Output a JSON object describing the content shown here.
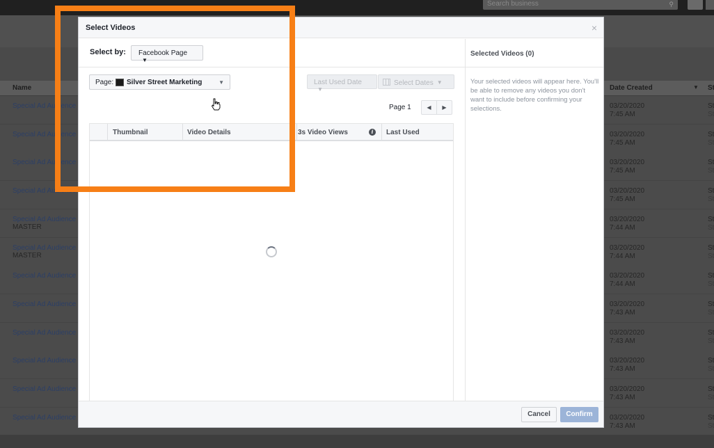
{
  "background": {
    "search_placeholder": "Search business",
    "columns": {
      "name": "Name",
      "date_created": "Date Created",
      "last_col": "St"
    },
    "rows": [
      {
        "name": "Special Ad Audience (",
        "name_line2": "",
        "date": "03/20/2020",
        "time": "7:45 AM",
        "s1": "St",
        "s2": "St"
      },
      {
        "name": "Special Ad Audience (",
        "name_line2": "",
        "date": "03/20/2020",
        "time": "7:45 AM",
        "s1": "St",
        "s2": "St"
      },
      {
        "name": "Special Ad Audience (",
        "name_line2": "",
        "date": "03/20/2020",
        "time": "7:45 AM",
        "s1": "St",
        "s2": "St"
      },
      {
        "name": "Special Ad Audience (",
        "name_line2": "",
        "date": "03/20/2020",
        "time": "7:45 AM",
        "s1": "St",
        "s2": "St"
      },
      {
        "name": "Special Ad Audience (",
        "name_line2": "MASTER",
        "date": "03/20/2020",
        "time": "7:44 AM",
        "s1": "St",
        "s2": "St"
      },
      {
        "name": "Special Ad Audience (",
        "name_line2": "MASTER",
        "date": "03/20/2020",
        "time": "7:44 AM",
        "s1": "St",
        "s2": "St"
      },
      {
        "name": "Special Ad Audience (",
        "name_line2": "",
        "date": "03/20/2020",
        "time": "7:44 AM",
        "s1": "St",
        "s2": "St"
      },
      {
        "name": "Special Ad Audience (",
        "name_line2": "",
        "date": "03/20/2020",
        "time": "7:43 AM",
        "s1": "St",
        "s2": "St"
      },
      {
        "name": "Special Ad Audience (",
        "name_line2": "",
        "date": "03/20/2020",
        "time": "7:43 AM",
        "s1": "St",
        "s2": "St"
      },
      {
        "name": "Special Ad Audience (",
        "name_line2": "",
        "date": "03/20/2020",
        "time": "7:43 AM",
        "s1": "St",
        "s2": "St"
      },
      {
        "name": "Special Ad Audience (",
        "name_line2": "",
        "date": "03/20/2020",
        "time": "7:43 AM",
        "s1": "St",
        "s2": "St"
      },
      {
        "name": "Special Ad Audience (",
        "name_line2": "",
        "date": "03/20/2020",
        "time": "7:43 AM",
        "s1": "St",
        "s2": "St"
      }
    ]
  },
  "dialog": {
    "title": "Select Videos",
    "close_glyph": "×",
    "select_by": {
      "label": "Select by:",
      "value": "Facebook Page"
    },
    "page_select": {
      "label": "Page:",
      "value": "Silver Street Marketing"
    },
    "filters": {
      "last_used_date": "Last Used Date",
      "select_dates": "Select Dates"
    },
    "pager": {
      "label": "Page 1",
      "prev": "◀",
      "next": "▶"
    },
    "table": {
      "columns": {
        "thumbnail": "Thumbnail",
        "video_details": "Video Details",
        "views": "3s Video Views",
        "last_used": "Last Used"
      },
      "info_glyph": "i"
    },
    "selected": {
      "title": "Selected Videos (0)",
      "empty_text": "Your selected videos will appear here. You'll be able to remove any videos you don't want to include before confirming your selections."
    },
    "footer": {
      "cancel": "Cancel",
      "confirm": "Confirm"
    }
  },
  "colors": {
    "highlight": "#f77f16",
    "confirm_disabled": "#9cb4d8",
    "link": "#2c3f66"
  }
}
